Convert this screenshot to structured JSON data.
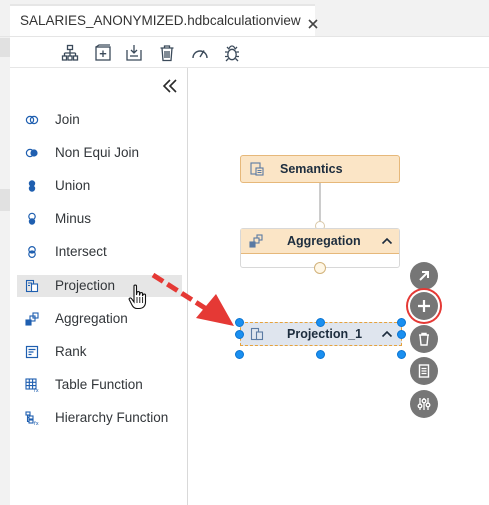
{
  "tab": {
    "title": "SALARIES_ANONYMIZED.hdbcalculationview"
  },
  "toolbar": {
    "icons": [
      "hierarchy-icon",
      "add-node-icon",
      "import-icon",
      "delete-icon",
      "performance-gauge-icon",
      "debug-bug-icon"
    ]
  },
  "palette": {
    "items": [
      {
        "label": "Join",
        "icon": "join-icon"
      },
      {
        "label": "Non Equi Join",
        "icon": "non-equi-join-icon"
      },
      {
        "label": "Union",
        "icon": "union-icon"
      },
      {
        "label": "Minus",
        "icon": "minus-icon"
      },
      {
        "label": "Intersect",
        "icon": "intersect-icon"
      },
      {
        "label": "Projection",
        "icon": "projection-icon",
        "selected": true
      },
      {
        "label": "Aggregation",
        "icon": "aggregation-icon"
      },
      {
        "label": "Rank",
        "icon": "rank-icon"
      },
      {
        "label": "Table Function",
        "icon": "table-function-icon"
      },
      {
        "label": "Hierarchy Function",
        "icon": "hierarchy-function-icon"
      }
    ]
  },
  "canvas": {
    "nodes": {
      "semantics": "Semantics",
      "aggregation": "Aggregation",
      "projection": "Projection_1"
    },
    "node_actions": [
      "open-icon",
      "add-icon",
      "delete-icon",
      "details-icon",
      "settings-icon"
    ]
  },
  "colors": {
    "node_header": "#fbe5c6",
    "selection_handle": "#1a8ff0",
    "callout_red": "#e53935"
  }
}
